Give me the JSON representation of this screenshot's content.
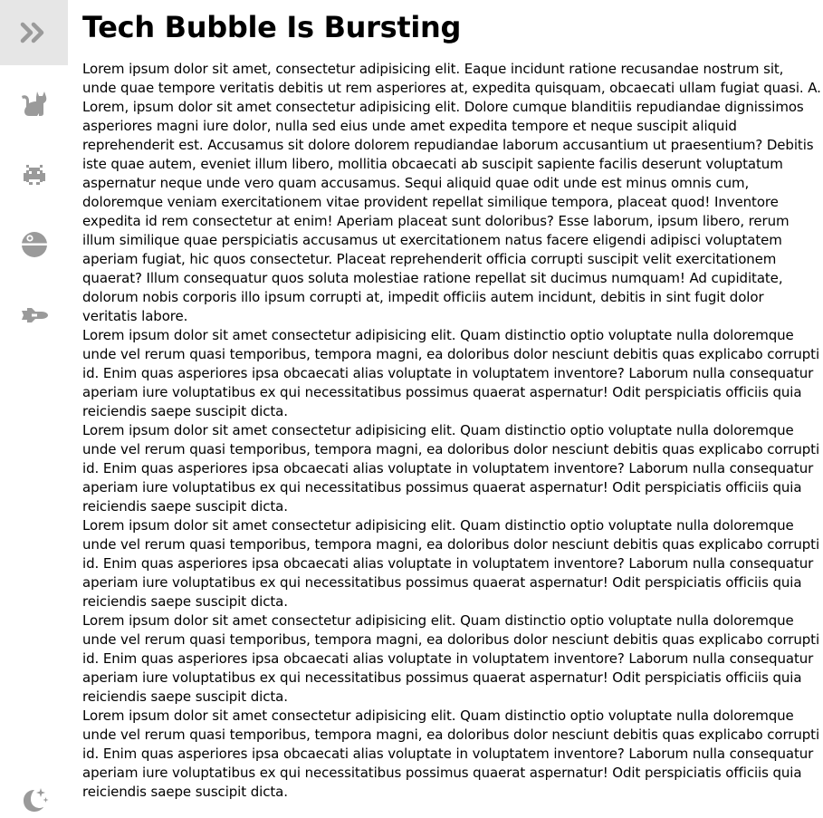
{
  "sidebar": {
    "items": [
      {
        "icon": "double-chevron-right-icon",
        "color": "#9a9a9a",
        "selected": true
      },
      {
        "icon": "cat-icon",
        "color": "#9a9a9a"
      },
      {
        "icon": "space-invader-icon",
        "color": "#9a9a9a"
      },
      {
        "icon": "death-star-icon",
        "color": "#9a9a9a"
      },
      {
        "icon": "space-shuttle-icon",
        "color": "#9a9a9a"
      },
      {
        "icon": "moon-stars-icon",
        "color": "#9a9a9a"
      }
    ]
  },
  "main": {
    "title": "Tech Bubble Is Bursting",
    "paragraphs": [
      "Lorem ipsum dolor sit amet, consectetur adipisicing elit. Eaque incidunt ratione recusandae nostrum sit, unde quae tempore veritatis debitis ut rem asperiores at, expedita quisquam, obcaecati ullam fugiat quasi. A.",
      "Lorem, ipsum dolor sit amet consectetur adipisicing elit. Dolore cumque blanditiis repudiandae dignissimos asperiores magni iure dolor, nulla sed eius unde amet expedita tempore et neque suscipit aliquid reprehenderit est. Accusamus sit dolore dolorem repudiandae laborum accusantium ut praesentium? Debitis iste quae autem, eveniet illum libero, mollitia obcaecati ab suscipit sapiente facilis deserunt voluptatum aspernatur neque unde vero quam accusamus. Sequi aliquid quae odit unde est minus omnis cum, doloremque veniam exercitationem vitae provident repellat similique tempora, placeat quod! Inventore expedita id rem consectetur at enim! Aperiam placeat sunt doloribus? Esse laborum, ipsum libero, rerum illum similique quae perspiciatis accusamus ut exercitationem natus facere eligendi adipisci voluptatem aperiam fugiat, hic quos consectetur. Placeat reprehenderit officia corrupti suscipit velit exercitationem quaerat? Illum consequatur quos soluta molestiae ratione repellat sit ducimus numquam! Ad cupiditate, dolorum nobis corporis illo ipsum corrupti at, impedit officiis autem incidunt, debitis in sint fugit dolor veritatis labore.",
      "Lorem ipsum dolor sit amet consectetur adipisicing elit. Quam distinctio optio voluptate nulla doloremque unde vel rerum quasi temporibus, tempora magni, ea doloribus dolor nesciunt debitis quas explicabo corrupti id. Enim quas asperiores ipsa obcaecati alias voluptate in voluptatem inventore? Laborum nulla consequatur aperiam iure voluptatibus ex qui necessitatibus possimus quaerat aspernatur! Odit perspiciatis officiis quia reiciendis saepe suscipit dicta.",
      "Lorem ipsum dolor sit amet consectetur adipisicing elit. Quam distinctio optio voluptate nulla doloremque unde vel rerum quasi temporibus, tempora magni, ea doloribus dolor nesciunt debitis quas explicabo corrupti id. Enim quas asperiores ipsa obcaecati alias voluptate in voluptatem inventore? Laborum nulla consequatur aperiam iure voluptatibus ex qui necessitatibus possimus quaerat aspernatur! Odit perspiciatis officiis quia reiciendis saepe suscipit dicta.",
      "Lorem ipsum dolor sit amet consectetur adipisicing elit. Quam distinctio optio voluptate nulla doloremque unde vel rerum quasi temporibus, tempora magni, ea doloribus dolor nesciunt debitis quas explicabo corrupti id. Enim quas asperiores ipsa obcaecati alias voluptate in voluptatem inventore? Laborum nulla consequatur aperiam iure voluptatibus ex qui necessitatibus possimus quaerat aspernatur! Odit perspiciatis officiis quia reiciendis saepe suscipit dicta.",
      "Lorem ipsum dolor sit amet consectetur adipisicing elit. Quam distinctio optio voluptate nulla doloremque unde vel rerum quasi temporibus, tempora magni, ea doloribus dolor nesciunt debitis quas explicabo corrupti id. Enim quas asperiores ipsa obcaecati alias voluptate in voluptatem inventore? Laborum nulla consequatur aperiam iure voluptatibus ex qui necessitatibus possimus quaerat aspernatur! Odit perspiciatis officiis quia reiciendis saepe suscipit dicta.",
      "Lorem ipsum dolor sit amet consectetur adipisicing elit. Quam distinctio optio voluptate nulla doloremque unde vel rerum quasi temporibus, tempora magni, ea doloribus dolor nesciunt debitis quas explicabo corrupti id. Enim quas asperiores ipsa obcaecati alias voluptate in voluptatem inventore? Laborum nulla consequatur aperiam iure voluptatibus ex qui necessitatibus possimus quaerat aspernatur! Odit perspiciatis officiis quia reiciendis saepe suscipit dicta."
    ]
  }
}
